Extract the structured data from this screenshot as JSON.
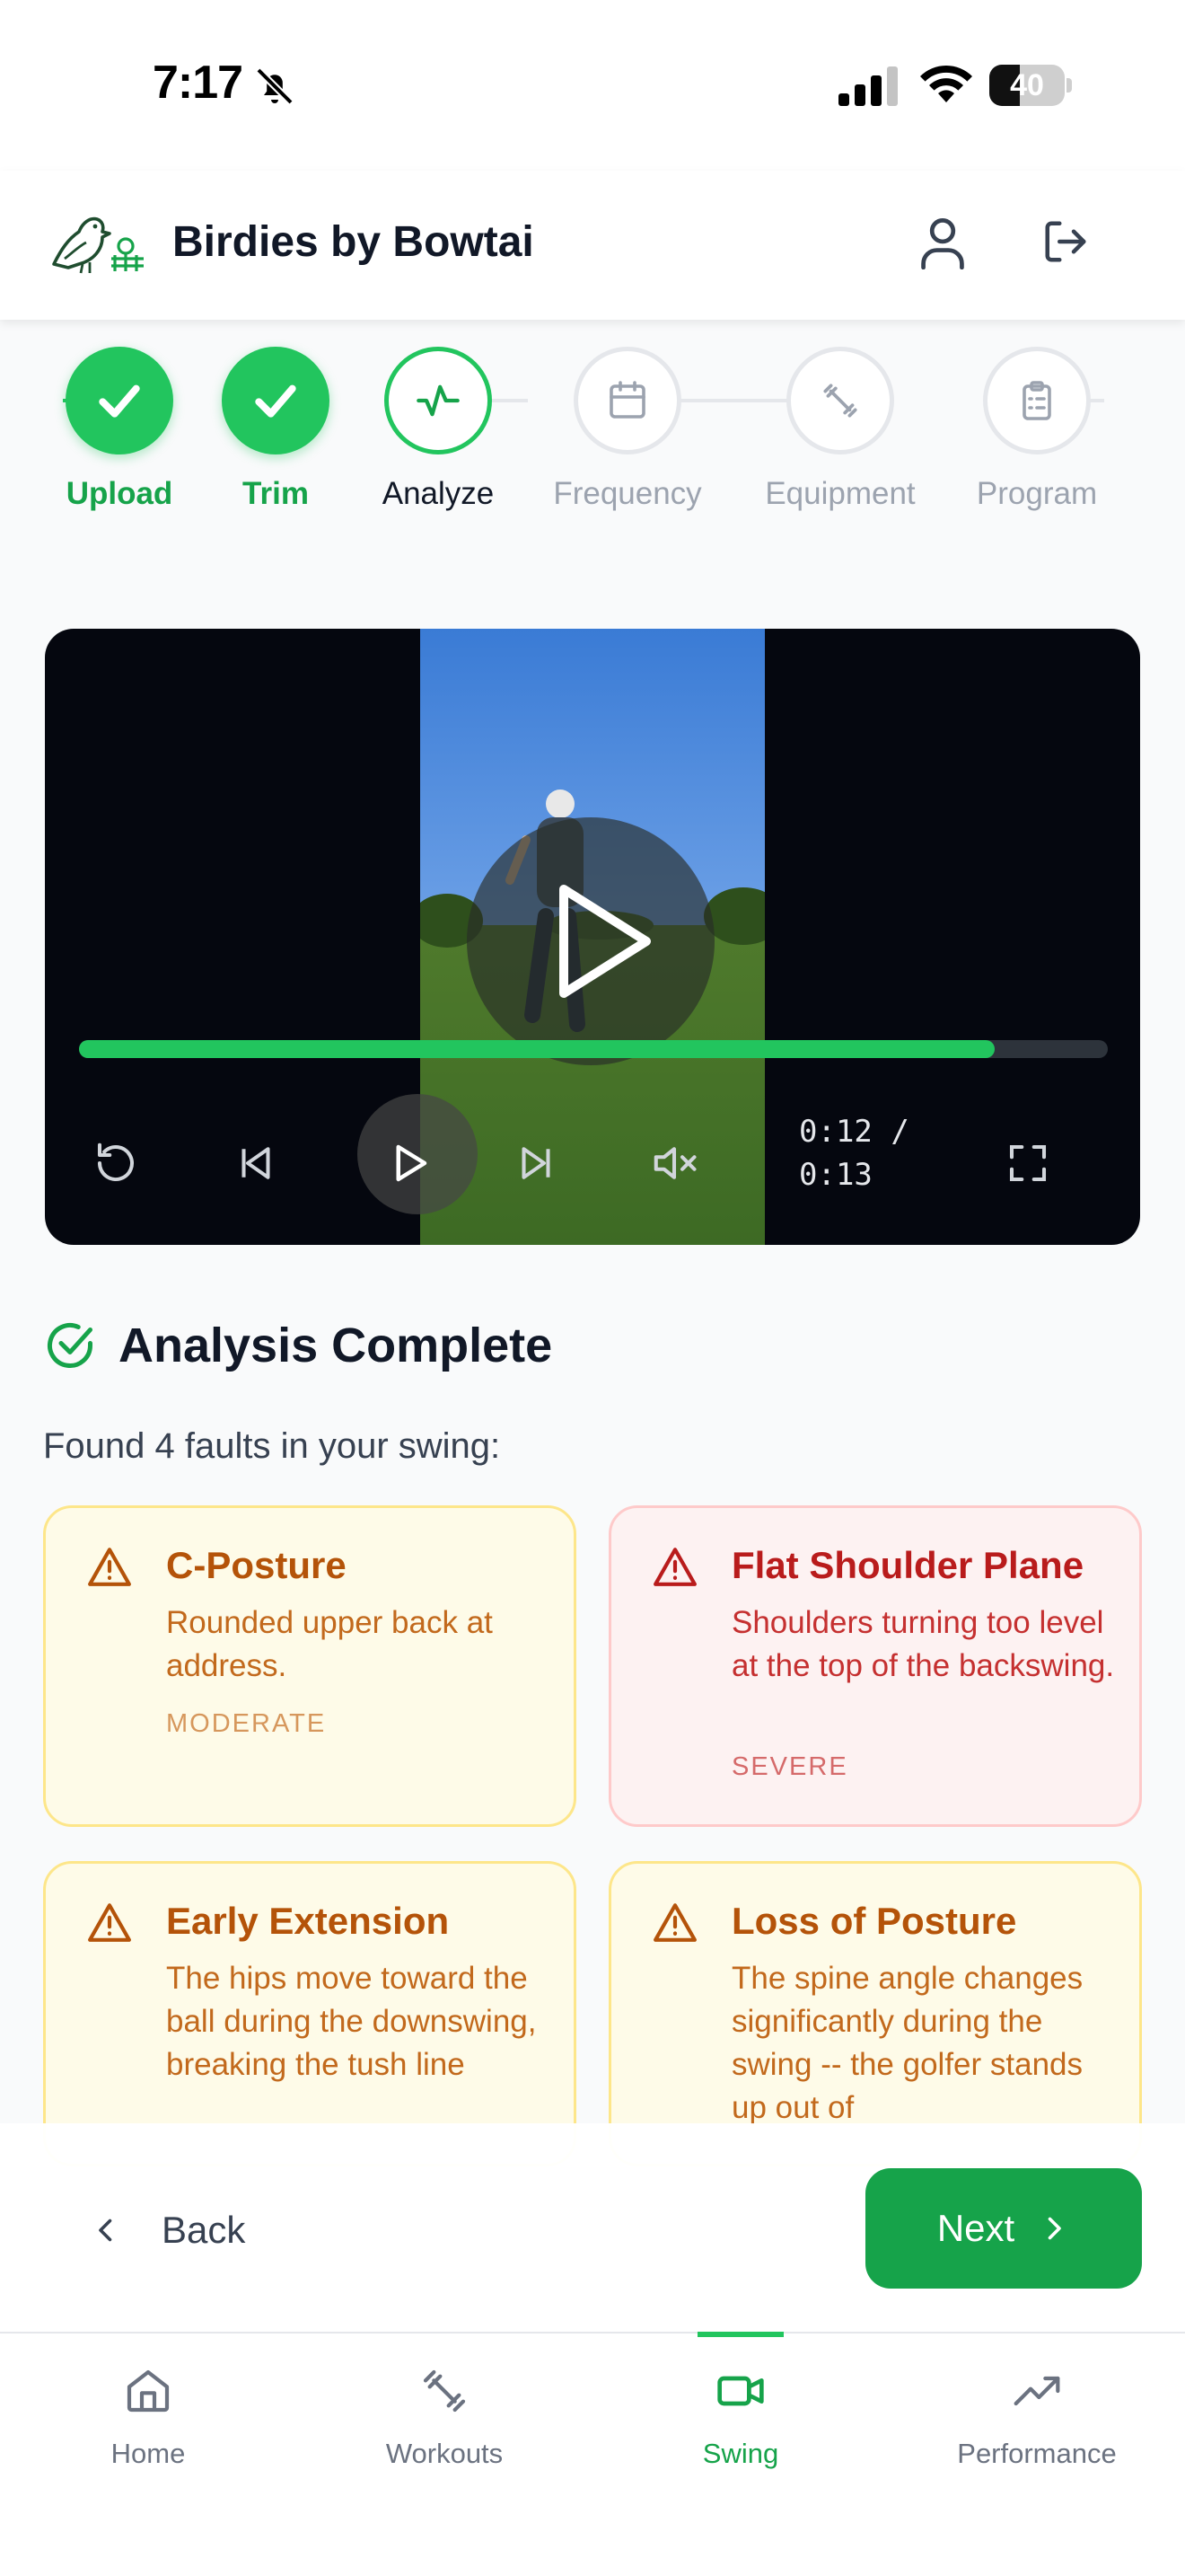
{
  "status_bar": {
    "time": "7:17",
    "battery": "40",
    "battery_level": 0.4
  },
  "header": {
    "title": "Birdies by Bowtai"
  },
  "stepper": {
    "steps": [
      {
        "label": "Upload",
        "state": "done"
      },
      {
        "label": "Trim",
        "state": "done"
      },
      {
        "label": "Analyze",
        "state": "current"
      },
      {
        "label": "Frequency",
        "state": "todo"
      },
      {
        "label": "Equipment",
        "state": "todo"
      },
      {
        "label": "Program",
        "state": "todo"
      }
    ]
  },
  "video": {
    "current_time": "0:12 /",
    "duration": "0:13",
    "progress": 0.89
  },
  "analysis": {
    "title": "Analysis Complete",
    "summary": "Found 4 faults in your swing:",
    "faults": [
      {
        "title": "C-Posture",
        "description": "Rounded upper back at address.",
        "severity": "MODERATE"
      },
      {
        "title": "Flat Shoulder Plane",
        "description": "Shoulders turning too level at the top of the backswing.",
        "severity": "SEVERE"
      },
      {
        "title": "Early Extension",
        "description": "The hips move toward the ball during the downswing, breaking the tush line",
        "severity": ""
      },
      {
        "title": "Loss of Posture",
        "description": "The spine angle changes significantly during the swing -- the golfer stands up out of",
        "severity": ""
      }
    ]
  },
  "actions": {
    "back_label": "Back",
    "next_label": "Next"
  },
  "tabs": [
    {
      "label": "Home",
      "icon": "home-icon"
    },
    {
      "label": "Workouts",
      "icon": "dumbbell-icon"
    },
    {
      "label": "Swing",
      "icon": "video-icon",
      "active": true
    },
    {
      "label": "Performance",
      "icon": "trending-up-icon"
    }
  ],
  "colors": {
    "accent": "#22c55e",
    "accent_dark": "#16a34a",
    "moderate": "#b45309",
    "severe": "#b91c1c"
  }
}
